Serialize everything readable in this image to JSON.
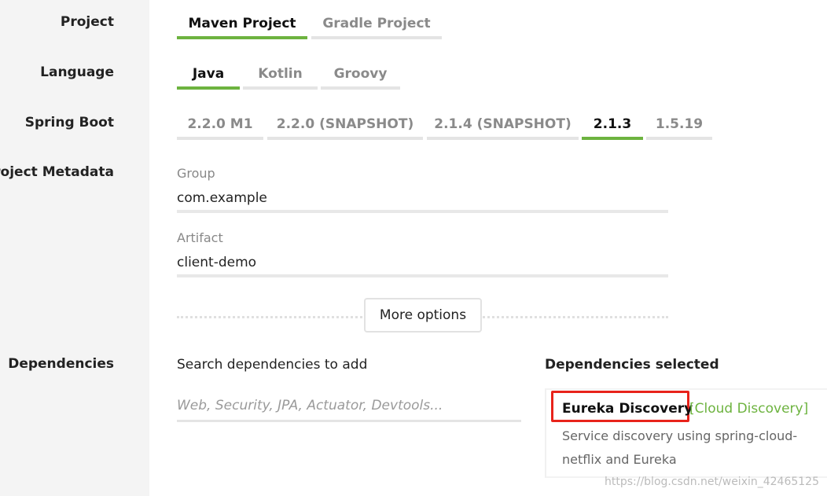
{
  "rows": {
    "project": "Project",
    "language": "Language",
    "spring_boot": "Spring Boot",
    "metadata": "Project Metadata",
    "dependencies": "Dependencies"
  },
  "project_tabs": [
    "Maven Project",
    "Gradle Project"
  ],
  "project_selected": "Maven Project",
  "language_tabs": [
    "Java",
    "Kotlin",
    "Groovy"
  ],
  "language_selected": "Java",
  "boot_tabs": [
    "2.2.0 M1",
    "2.2.0 (SNAPSHOT)",
    "2.1.4 (SNAPSHOT)",
    "2.1.3",
    "1.5.19"
  ],
  "boot_selected": "2.1.3",
  "metadata": {
    "group_label": "Group",
    "group_value": "com.example",
    "artifact_label": "Artifact",
    "artifact_value": "client-demo",
    "more_options": "More options"
  },
  "dependencies": {
    "search_label": "Search dependencies to add",
    "search_placeholder": "Web, Security, JPA, Actuator, Devtools...",
    "selected_title": "Dependencies selected",
    "selected": [
      {
        "name": "Eureka Discovery",
        "group": "[Cloud Discovery]",
        "description": "Service discovery using spring-cloud-netflix and Eureka"
      }
    ]
  },
  "watermark": "https://blog.csdn.net/weixin_42465125",
  "colors": {
    "accent": "#6db33f",
    "highlight": "#e8231b",
    "sidebar_bg": "#f4f4f4"
  }
}
